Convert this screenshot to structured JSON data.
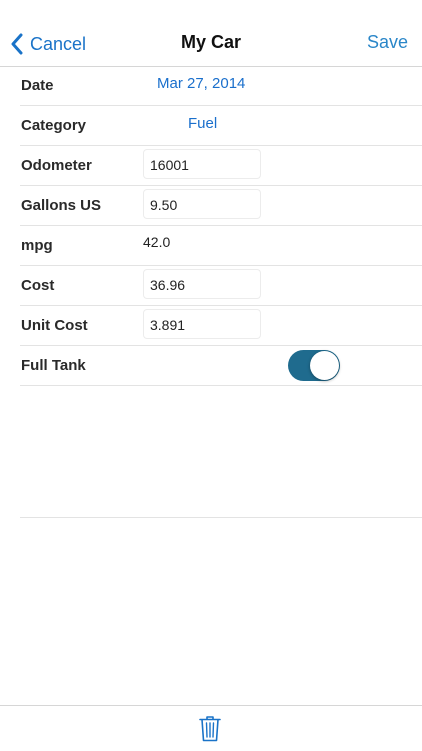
{
  "nav": {
    "cancel_label": "Cancel",
    "title": "My Car",
    "save_label": "Save"
  },
  "form": {
    "date": {
      "label": "Date",
      "value": "Mar 27, 2014"
    },
    "category": {
      "label": "Category",
      "value": "Fuel"
    },
    "odometer": {
      "label": "Odometer",
      "value": "16001"
    },
    "gallons": {
      "label": "Gallons US",
      "value": "9.50"
    },
    "mpg": {
      "label": "mpg",
      "value": "42.0"
    },
    "cost": {
      "label": "Cost",
      "value": "36.96"
    },
    "unit_cost": {
      "label": "Unit Cost",
      "value": "3.891"
    },
    "full_tank": {
      "label": "Full Tank",
      "on": true
    }
  },
  "toolbar": {
    "delete_icon": "trash-icon"
  },
  "colors": {
    "accent": "#1a73c8",
    "toggle_on": "#1f6b8e"
  }
}
